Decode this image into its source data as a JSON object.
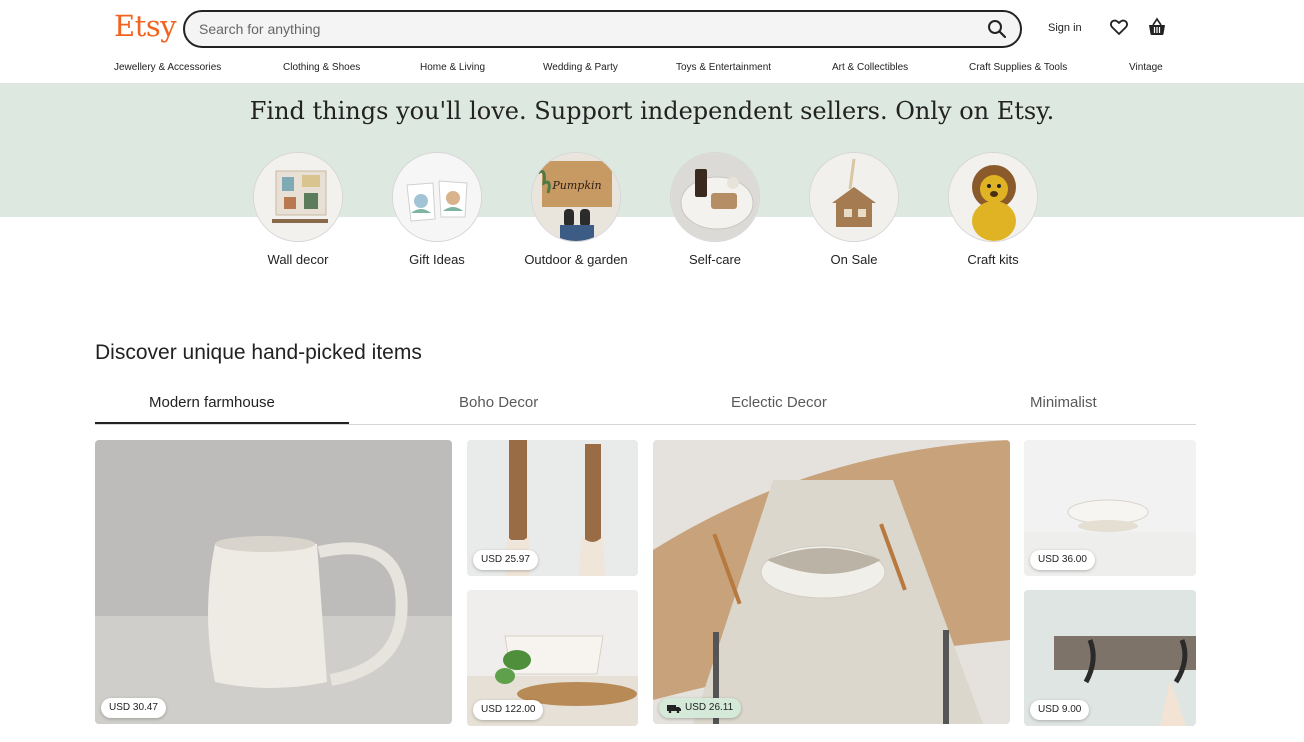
{
  "header": {
    "logo": "Etsy",
    "search_placeholder": "Search for anything",
    "sign_in": "Sign in"
  },
  "nav": [
    "Jewellery & Accessories",
    "Clothing & Shoes",
    "Home & Living",
    "Wedding & Party",
    "Toys & Entertainment",
    "Art & Collectibles",
    "Craft Supplies & Tools",
    "Vintage"
  ],
  "hero": {
    "title": "Find things you'll love. Support independent sellers. Only on Etsy.",
    "categories": [
      "Wall decor",
      "Gift Ideas",
      "Outdoor & garden",
      "Self-care",
      "On Sale",
      "Craft kits"
    ]
  },
  "discover": {
    "title": "Discover unique hand-picked items",
    "tabs": [
      "Modern farmhouse",
      "Boho Decor",
      "Eclectic Decor",
      "Minimalist"
    ],
    "active_tab": "Modern farmhouse",
    "items": [
      {
        "price": "USD 30.47"
      },
      {
        "price": "USD 25.97"
      },
      {
        "price": "USD 122.00"
      },
      {
        "price": "USD 26.11",
        "free_delivery": true
      },
      {
        "price": "USD 36.00"
      },
      {
        "price": "USD 9.00"
      }
    ]
  },
  "colors": {
    "brand": "#f1641e",
    "band": "#dde8e0",
    "sale_badge": "#d4e9d7"
  }
}
